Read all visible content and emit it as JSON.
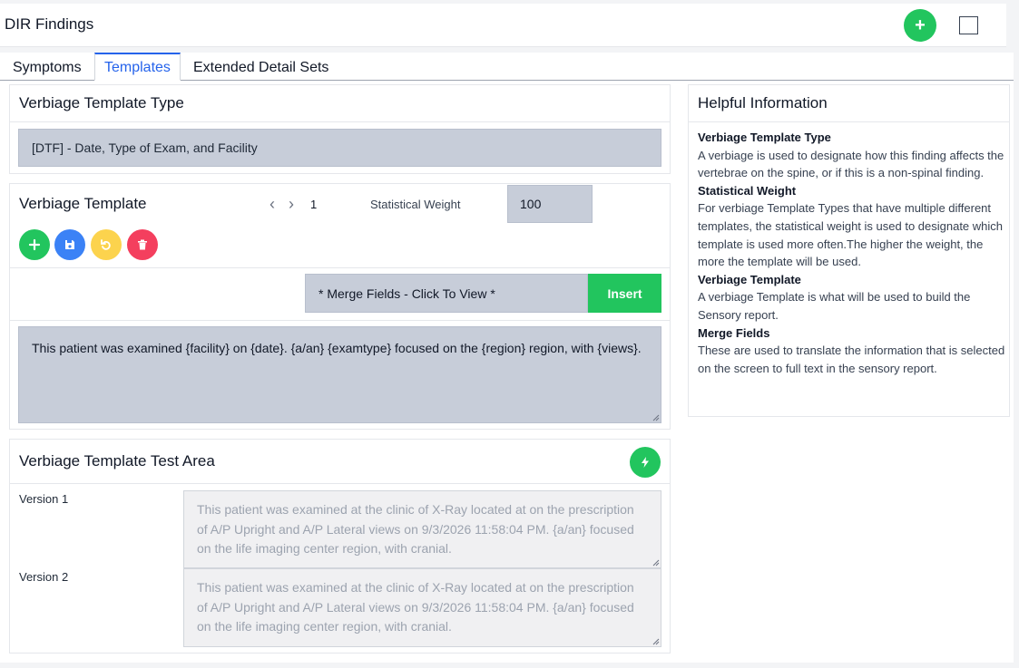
{
  "header": {
    "title": "DIR Findings"
  },
  "tabs": [
    {
      "label": "Symptoms"
    },
    {
      "label": "Templates"
    },
    {
      "label": "Extended Detail Sets"
    }
  ],
  "template_type": {
    "title": "Verbiage Template Type",
    "selected": "[DTF] - Date, Type of Exam, and Facility"
  },
  "template": {
    "title": "Verbiage Template",
    "page": "1",
    "weight_label": "Statistical Weight",
    "weight_value": "100",
    "merge_fields": "* Merge Fields - Click To View *",
    "insert_label": "Insert",
    "text": "This patient was examined {facility} on {date}. {a/an} {examtype} focused on the {region} region, with {views}."
  },
  "test_area": {
    "title": "Verbiage Template Test Area",
    "versions": [
      {
        "label": "Version 1",
        "text": "This patient was examined at the clinic of X-Ray located at on the prescription of A/P Upright and A/P Lateral views on 9/3/2026 11:58:04 PM. {a/an} focused on the life imaging center region, with cranial."
      },
      {
        "label": "Version 2",
        "text": "This patient was examined at the clinic of X-Ray located at on the prescription of A/P Upright and A/P Lateral views on 9/3/2026 11:58:04 PM. {a/an} focused on the life imaging center region, with cranial."
      }
    ]
  },
  "help": {
    "title": "Helpful Information",
    "sections": [
      {
        "heading": "Verbiage Template Type",
        "text": "A verbiage is used to designate how this finding affects the vertebrae on the spine, or if this is a non-spinal finding."
      },
      {
        "heading": "Statistical Weight",
        "text": "For verbiage Template Types that have multiple different templates, the statistical weight is used to designate which template is used more often.The higher the weight, the more the template will be used."
      },
      {
        "heading": "Verbiage Template",
        "text": "A verbiage Template is what will be used to build the Sensory report."
      },
      {
        "heading": "Merge Fields",
        "text": "These are used to translate the information that is selected on the screen to full text in the sensory report."
      }
    ]
  },
  "colors": {
    "accent": "#2563eb",
    "success": "#22c55e",
    "primary": "#3b82f6",
    "warning": "#fcd34d",
    "danger": "#f43f5e",
    "field": "#c7cdd9"
  }
}
